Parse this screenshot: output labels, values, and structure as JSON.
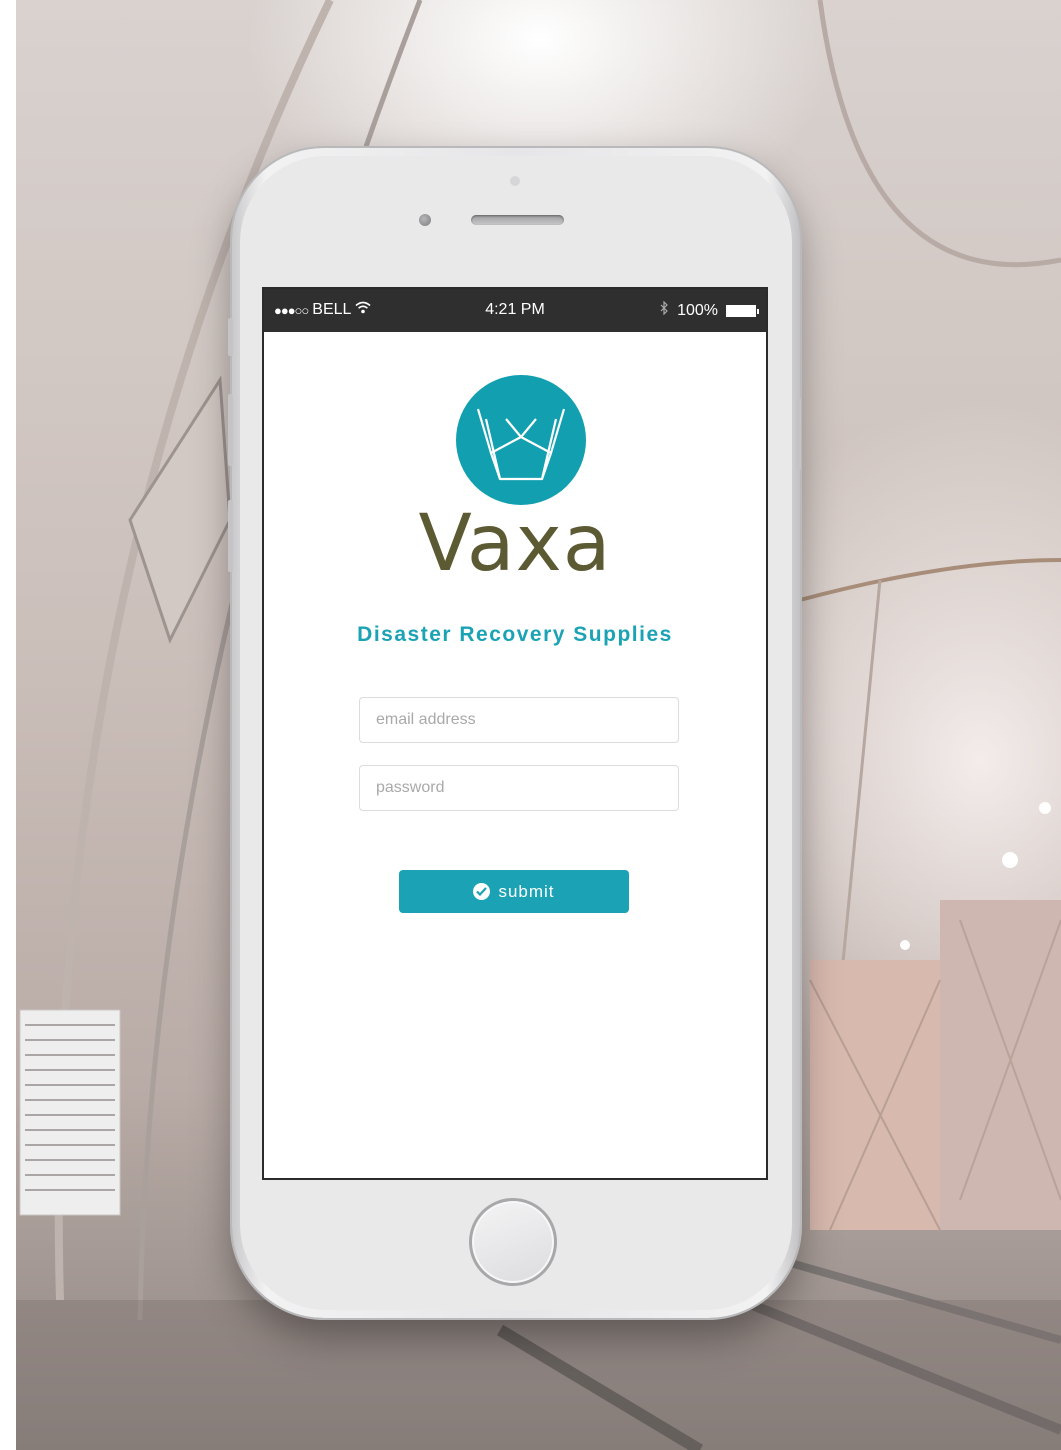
{
  "status_bar": {
    "carrier": "BELL",
    "signal_dots": "●●●○○",
    "time": "4:21 PM",
    "battery": "100%"
  },
  "app": {
    "name": "Vaxa",
    "tagline": "Disaster Recovery Supplies",
    "brand_color": "#1ba3b5",
    "name_color": "#5b5a32"
  },
  "form": {
    "email_placeholder": "email address",
    "password_placeholder": "password",
    "submit_label": "submit"
  }
}
